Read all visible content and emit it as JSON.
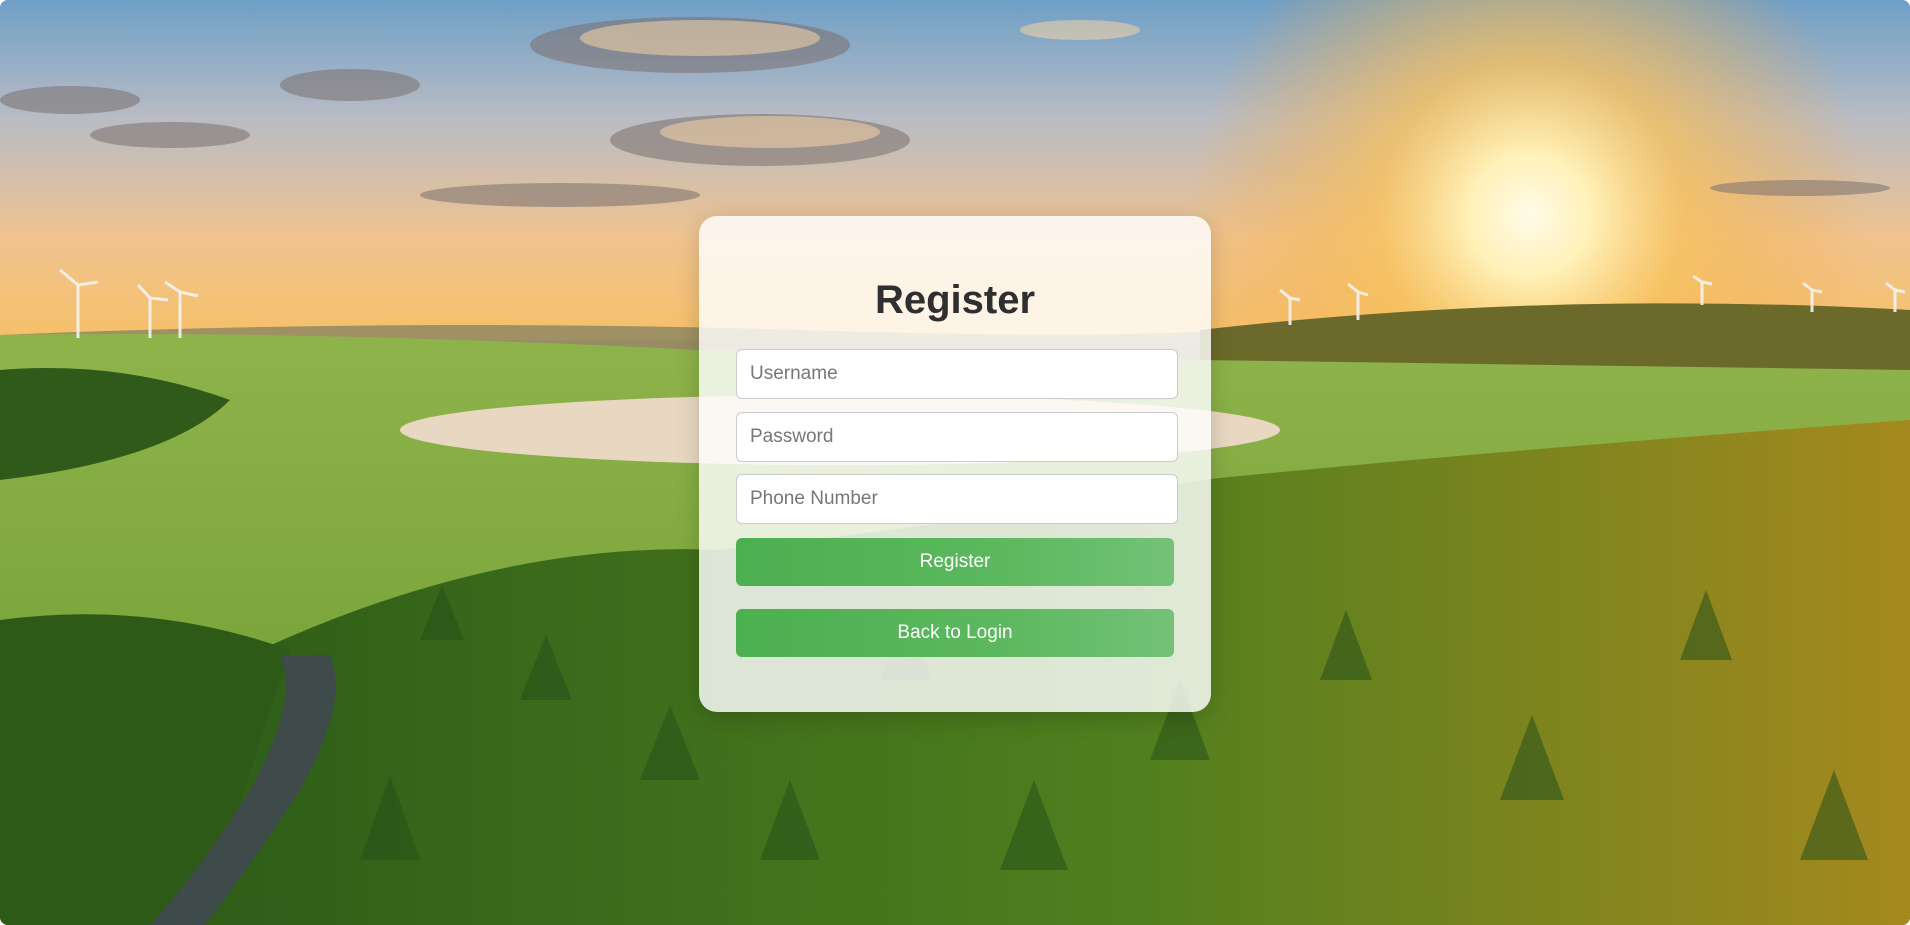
{
  "form": {
    "title": "Register",
    "fields": [
      {
        "name": "username",
        "placeholder": "Username",
        "value": ""
      },
      {
        "name": "password",
        "placeholder": "Password",
        "value": ""
      },
      {
        "name": "phone",
        "placeholder": "Phone Number",
        "value": ""
      }
    ],
    "register_label": "Register",
    "back_label": "Back to Login"
  },
  "colors": {
    "button": "#4caf50",
    "card": "#ffffff",
    "title": "#2f2f2f"
  },
  "background": {
    "description_icon": "landscape-image"
  }
}
